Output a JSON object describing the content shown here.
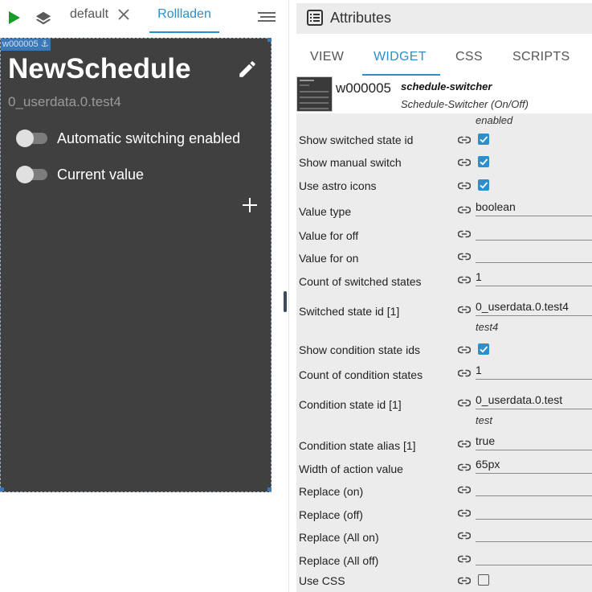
{
  "toolbar": {
    "tabs": [
      {
        "label": "default",
        "active": false,
        "closable": true
      },
      {
        "label": "Rollladen",
        "active": true
      }
    ]
  },
  "widget": {
    "id_badge": "w000005",
    "title": "NewSchedule",
    "oid": "0_userdata.0.test4",
    "switches": [
      {
        "label": "Automatic switching enabled",
        "on": false
      },
      {
        "label": "Current value",
        "on": false
      }
    ]
  },
  "attributes": {
    "title": "Attributes",
    "tabs": [
      "VIEW",
      "WIDGET",
      "CSS",
      "SCRIPTS"
    ],
    "active_tab": "WIDGET",
    "widget_info": {
      "id": "w000005",
      "type": "schedule-switcher",
      "description": "Schedule-Switcher (On/Off)"
    },
    "scrolled_note": "enabled",
    "rows": [
      {
        "label": "Show switched state id",
        "kind": "checkbox",
        "checked": true
      },
      {
        "label": "Show manual switch",
        "kind": "checkbox",
        "checked": true
      },
      {
        "label": "Use astro icons",
        "kind": "checkbox",
        "checked": true
      },
      {
        "label": "Value type",
        "kind": "input",
        "value": "boolean"
      },
      {
        "label": "Value for off",
        "kind": "input",
        "value": ""
      },
      {
        "label": "Value for on",
        "kind": "input",
        "value": ""
      },
      {
        "label": "Count of switched states",
        "kind": "input",
        "value": "1"
      },
      {
        "label": "Switched state id [1]",
        "kind": "input",
        "value": "0_userdata.0.test4",
        "sub": "test4"
      },
      {
        "label": "Show condition state ids",
        "kind": "checkbox",
        "checked": true
      },
      {
        "label": "Count of condition states",
        "kind": "input",
        "value": "1"
      },
      {
        "label": "Condition state id [1]",
        "kind": "input",
        "value": "0_userdata.0.test",
        "sub": "test"
      },
      {
        "label": "Condition state alias [1]",
        "kind": "input",
        "value": "true"
      },
      {
        "label": "Width of action value",
        "kind": "input",
        "value": "65px"
      },
      {
        "label": "Replace (on)",
        "kind": "input",
        "value": ""
      },
      {
        "label": "Replace (off)",
        "kind": "input",
        "value": ""
      },
      {
        "label": "Replace (All on)",
        "kind": "input",
        "value": ""
      },
      {
        "label": "Replace (All off)",
        "kind": "input",
        "value": ""
      },
      {
        "label": "Use CSS",
        "kind": "checkbox",
        "checked": false
      }
    ]
  },
  "colors": {
    "accent": "#2a8fcc",
    "widget_bg": "#404040",
    "panel_bg": "#ececec",
    "play": "#1a9c2a"
  }
}
